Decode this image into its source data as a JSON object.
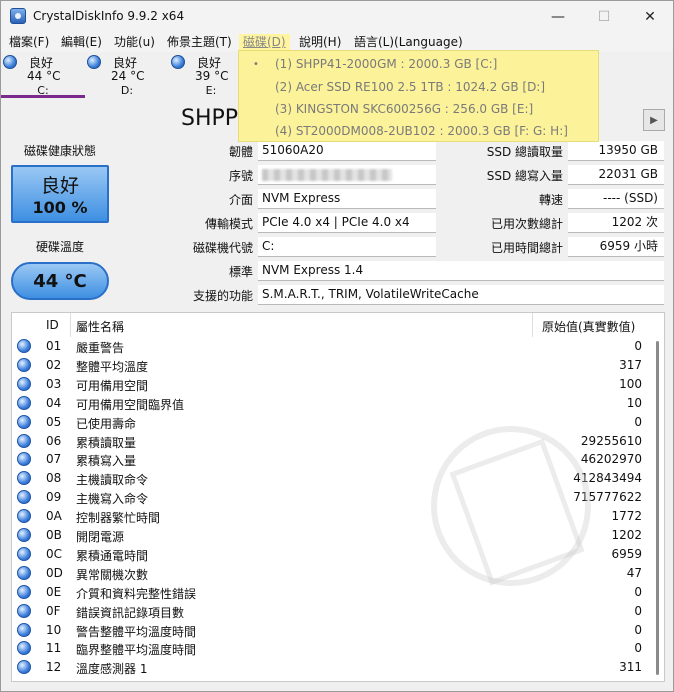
{
  "window": {
    "title": "CrystalDiskInfo 9.9.2 x64",
    "minimize": "—",
    "maximize": "☐",
    "close": "✕"
  },
  "menu": [
    "檔案(F)",
    "編輯(E)",
    "功能(u)",
    "佈景主題(T)",
    "磁碟(D)",
    "說明(H)",
    "語言(L)(Language)"
  ],
  "drives": [
    {
      "status": "良好",
      "temp": "44 °C",
      "letter": "C:"
    },
    {
      "status": "良好",
      "temp": "24 °C",
      "letter": "D:"
    },
    {
      "status": "良好",
      "temp": "39 °C",
      "letter": "E:"
    }
  ],
  "disk_menu": {
    "bullet": "•",
    "items": [
      "(1) SHPP41-2000GM : 2000.3 GB [C:]",
      "(2) Acer SSD RE100 2.5 1TB : 1024.2 GB [D:]",
      "(3) KINGSTON SKC600256G : 256.0 GB [E:]",
      "(4) ST2000DM008-2UB102 : 2000.3 GB [F: G: H:]"
    ]
  },
  "model_title": "SHPP",
  "next_arrow": "▶",
  "health": {
    "label": "磁碟健康狀態",
    "status": "良好",
    "percent": "100 %"
  },
  "temperature": {
    "label": "硬碟溫度",
    "value": "44 °C"
  },
  "info": {
    "firmware_label": "韌體",
    "firmware": "51060A20",
    "serial_label": "序號",
    "interface_label": "介面",
    "interface": "NVM Express",
    "transfer_label": "傳輸模式",
    "transfer": "PCIe 4.0 x4 | PCIe 4.0 x4",
    "drive_letter_label": "磁碟機代號",
    "drive_letter": "C:",
    "standard_label": "標準",
    "standard": "NVM Express 1.4",
    "features_label": "支援的功能",
    "features": "S.M.A.R.T., TRIM, VolatileWriteCache",
    "host_reads_label": "SSD 總讀取量",
    "host_reads": "13950 GB",
    "host_writes_label": "SSD 總寫入量",
    "host_writes": "22031 GB",
    "rotation_label": "轉速",
    "rotation": "---- (SSD)",
    "power_count_label": "已用次數總計",
    "power_count": "1202 次",
    "power_hours_label": "已用時間總計",
    "power_hours": "6959 小時"
  },
  "smart": {
    "headers": {
      "id": "ID",
      "name": "屬性名稱",
      "raw": "原始值(真實數值)"
    },
    "rows": [
      {
        "id": "01",
        "name": "嚴重警告",
        "raw": "0"
      },
      {
        "id": "02",
        "name": "整體平均溫度",
        "raw": "317"
      },
      {
        "id": "03",
        "name": "可用備用空間",
        "raw": "100"
      },
      {
        "id": "04",
        "name": "可用備用空間臨界值",
        "raw": "10"
      },
      {
        "id": "05",
        "name": "已使用壽命",
        "raw": "0"
      },
      {
        "id": "06",
        "name": "累積讀取量",
        "raw": "29255610"
      },
      {
        "id": "07",
        "name": "累積寫入量",
        "raw": "46202970"
      },
      {
        "id": "08",
        "name": "主機讀取命令",
        "raw": "412843494"
      },
      {
        "id": "09",
        "name": "主機寫入命令",
        "raw": "715777622"
      },
      {
        "id": "0A",
        "name": "控制器繁忙時間",
        "raw": "1772"
      },
      {
        "id": "0B",
        "name": "開閉電源",
        "raw": "1202"
      },
      {
        "id": "0C",
        "name": "累積通電時間",
        "raw": "6959"
      },
      {
        "id": "0D",
        "name": "異常關機次數",
        "raw": "47"
      },
      {
        "id": "0E",
        "name": "介質和資料完整性錯誤",
        "raw": "0"
      },
      {
        "id": "0F",
        "name": "錯誤資訊記錄項目數",
        "raw": "0"
      },
      {
        "id": "10",
        "name": "警告整體平均溫度時間",
        "raw": "0"
      },
      {
        "id": "11",
        "name": "臨界整體平均溫度時間",
        "raw": "0"
      },
      {
        "id": "12",
        "name": "溫度感測器 1",
        "raw": "311"
      }
    ]
  }
}
